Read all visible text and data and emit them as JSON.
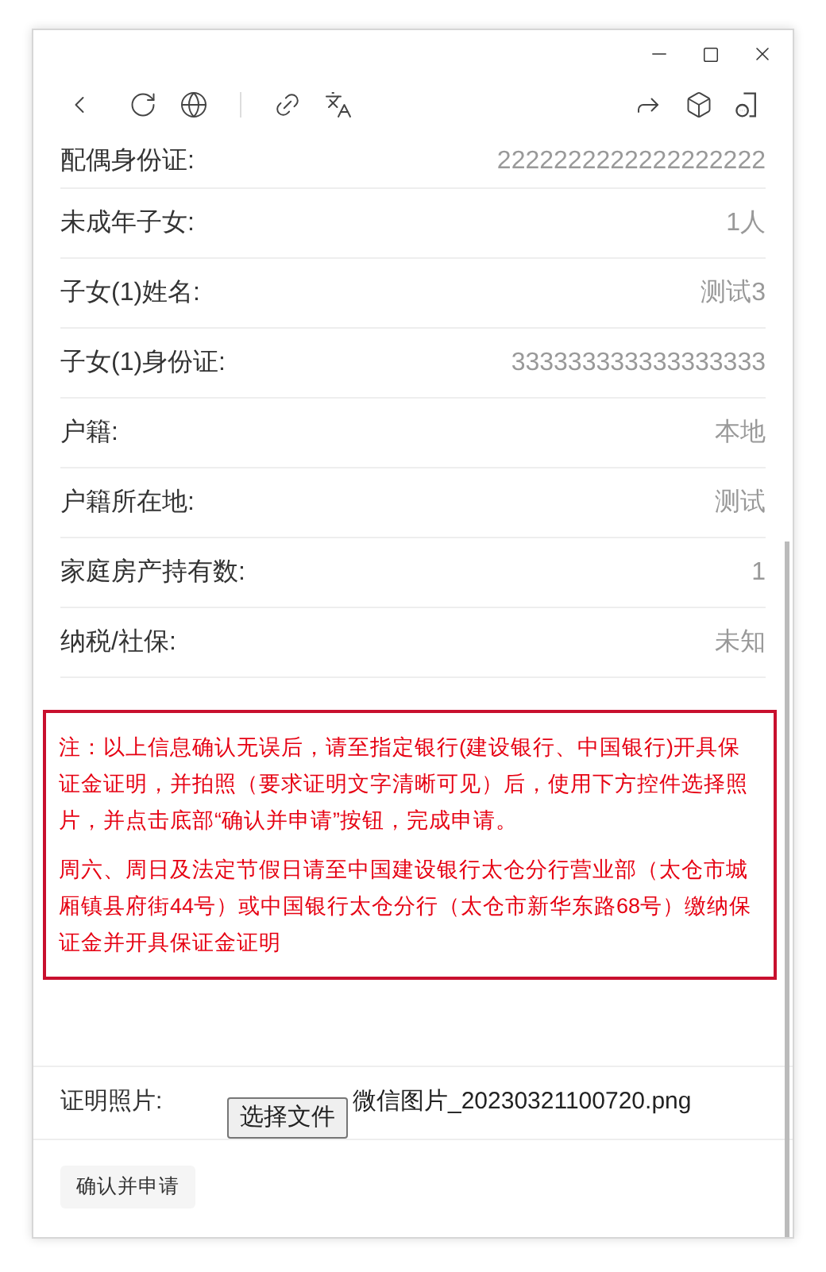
{
  "rows": [
    {
      "label": "配偶身份证:",
      "value": "2222222222222222222"
    },
    {
      "label": "未成年子女:",
      "value": "1人"
    },
    {
      "label": "子女(1)姓名:",
      "value": "测试3"
    },
    {
      "label": "子女(1)身份证:",
      "value": "333333333333333333"
    },
    {
      "label": "户籍:",
      "value": "本地"
    },
    {
      "label": "户籍所在地:",
      "value": "测试"
    },
    {
      "label": "家庭房产持有数:",
      "value": "1"
    },
    {
      "label": "纳税/社保:",
      "value": "未知"
    }
  ],
  "notice": [
    "注：以上信息确认无误后，请至指定银行(建设银行、中国银行)开具保证金证明，并拍照（要求证明文字清晰可见）后，使用下方控件选择照片，并点击底部“确认并申请”按钮，完成申请。",
    "周六、周日及法定节假日请至中国建设银行太仓分行营业部（太仓市城厢镇县府街44号）或中国银行太仓分行（太仓市新华东路68号）缴纳保证金并开具保证金证明"
  ],
  "photo": {
    "label": "证明照片:",
    "button": "选择文件",
    "file_name": "微信图片_20230321100720.png"
  },
  "submit": "确认并申请"
}
